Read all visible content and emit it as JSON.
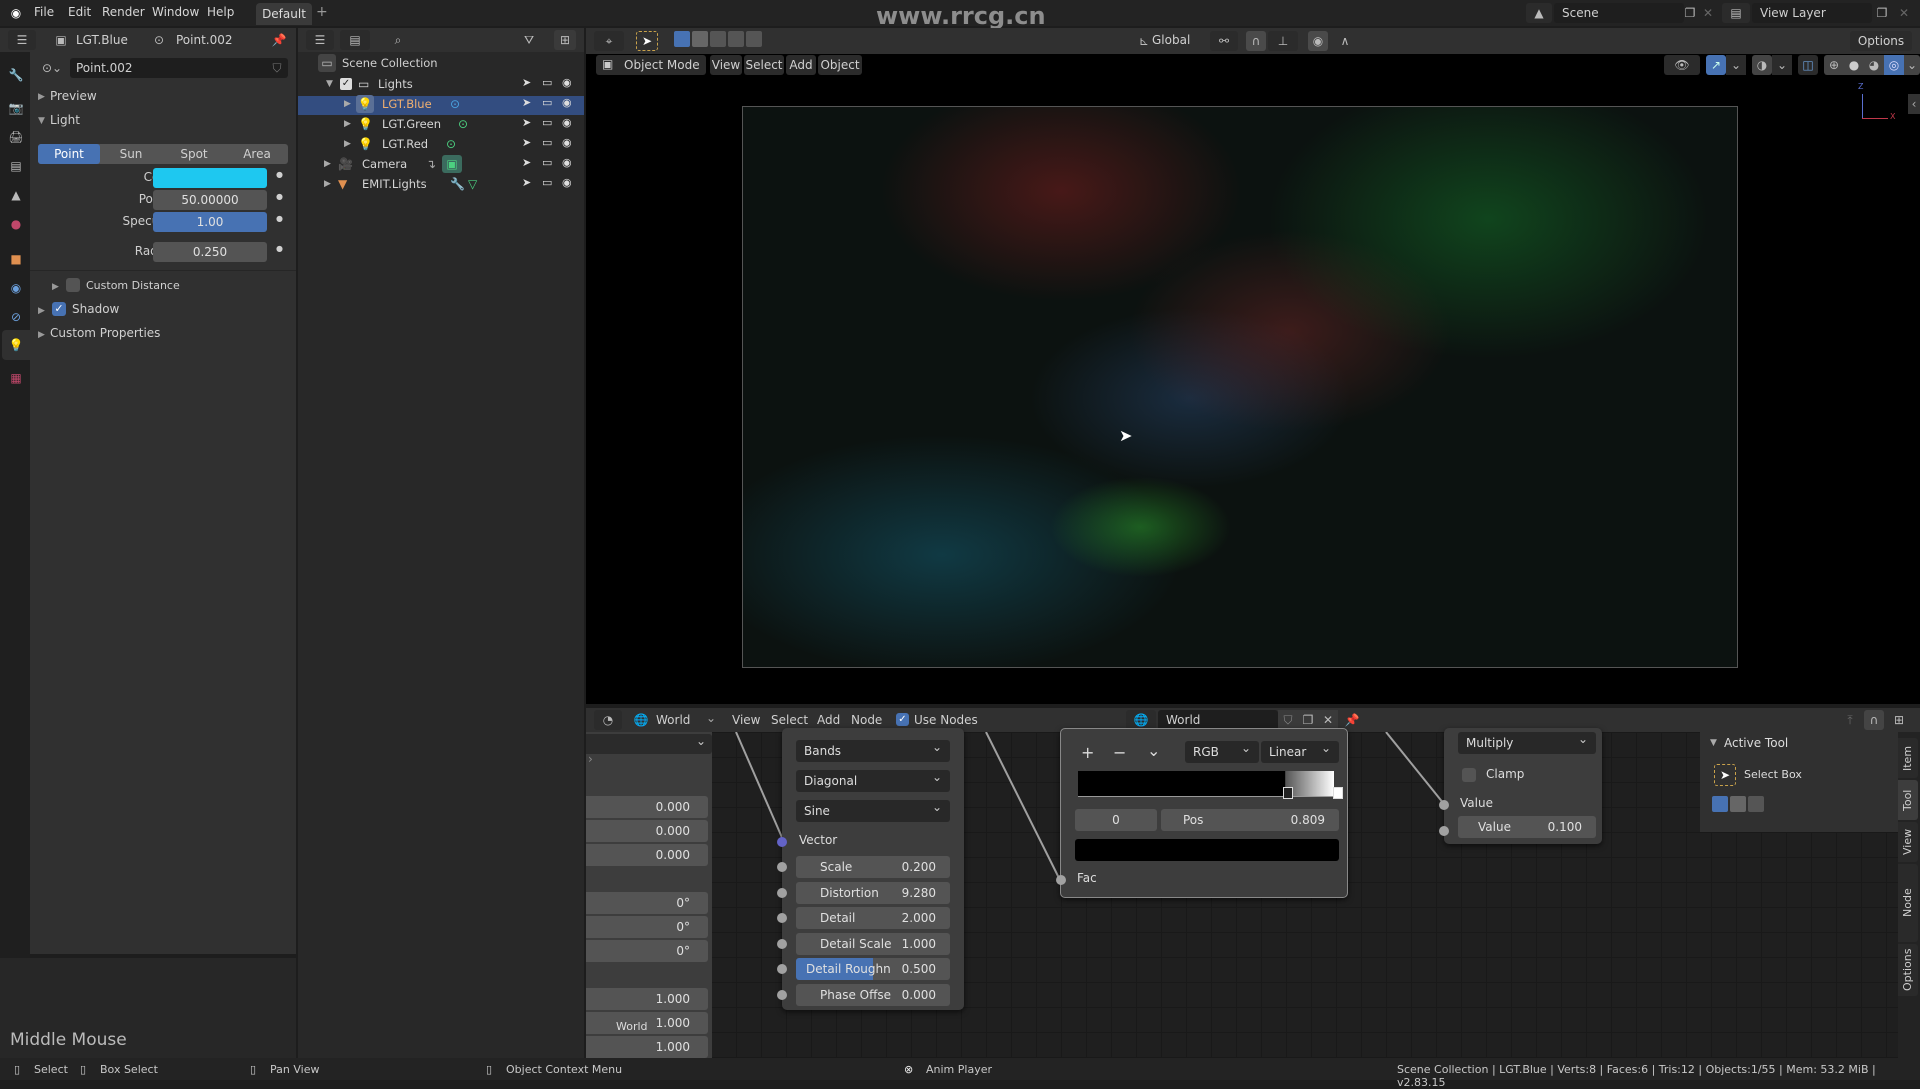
{
  "topbar": {
    "menus": [
      "File",
      "Edit",
      "Render",
      "Window",
      "Help"
    ],
    "workspace_tab": "Default",
    "scene": "Scene",
    "view_layer": "View Layer",
    "watermark": "www.rrcg.cn"
  },
  "properties": {
    "object_name": "LGT.Blue",
    "data_name": "Point.002",
    "datablock": "Point.002",
    "panels": {
      "preview": "Preview",
      "light": "Light",
      "custom_distance": "Custom Distance",
      "shadow": "Shadow",
      "custom_properties": "Custom Properties"
    },
    "light_types": [
      "Point",
      "Sun",
      "Spot",
      "Area"
    ],
    "active_type": "Point",
    "fields": {
      "color_label": "Color",
      "power_label": "Power",
      "power": "50.00000",
      "specular_label": "Specular",
      "specular": "1.00",
      "radius_label": "Radius",
      "radius": "0.250"
    },
    "color_value": "#1ec8f0",
    "shadow_checked": true,
    "custom_distance_checked": false
  },
  "outliner": {
    "root": "Scene Collection",
    "items": [
      {
        "name": "Lights",
        "type": "collection"
      },
      {
        "name": "LGT.Blue",
        "type": "light",
        "selected": true
      },
      {
        "name": "LGT.Green",
        "type": "light"
      },
      {
        "name": "LGT.Red",
        "type": "light"
      },
      {
        "name": "Camera",
        "type": "camera"
      },
      {
        "name": "EMIT.Lights",
        "type": "mesh"
      }
    ]
  },
  "viewport": {
    "mode": "Object Mode",
    "menus": [
      "View",
      "Select",
      "Add",
      "Object"
    ],
    "orientation": "Global",
    "options": "Options",
    "axis_z": "Z",
    "axis_x": "X"
  },
  "node_editor": {
    "editor_type": "World",
    "menus": [
      "View",
      "Select",
      "Add",
      "Node"
    ],
    "use_nodes_label": "Use Nodes",
    "use_nodes": true,
    "world_name": "World",
    "left_panel": {
      "values": [
        "0.000",
        "0.000",
        "0.000",
        "0°",
        "0°",
        "0°",
        "1.000",
        "1.000",
        "1.000"
      ],
      "label": "World"
    },
    "wave_node": {
      "dropdowns": [
        "Bands",
        "Diagonal",
        "Sine"
      ],
      "vector": "Vector",
      "inputs": [
        {
          "k": "Scale",
          "v": "0.200"
        },
        {
          "k": "Distortion",
          "v": "9.280"
        },
        {
          "k": "Detail",
          "v": "2.000"
        },
        {
          "k": "Detail Scale",
          "v": "1.000"
        },
        {
          "k": "Detail Roughn",
          "v": "0.500"
        },
        {
          "k": "Phase Offse",
          "v": "0.000"
        }
      ]
    },
    "ramp_node": {
      "color_mode": "RGB",
      "interpolation": "Linear",
      "index": "0",
      "pos_label": "Pos",
      "pos": "0.809",
      "fac": "Fac",
      "plus": "+",
      "minus": "−",
      "chevron": "⌄"
    },
    "math_node": {
      "operation": "Multiply",
      "clamp": "Clamp",
      "value_socket": "Value",
      "value_label": "Value",
      "value": "0.100"
    },
    "sidebar": {
      "active_tool": "Active Tool",
      "select_box": "Select Box",
      "tabs": [
        "Item",
        "Tool",
        "View",
        "Node Wrangler",
        "Options"
      ]
    }
  },
  "statusbar": {
    "select": "Select",
    "box_select": "Box Select",
    "pan_view": "Pan View",
    "context_menu": "Object Context Menu",
    "anim_player": "Anim Player",
    "info": "Scene Collection | LGT.Blue | Verts:8 | Faces:6 | Tris:12 | Objects:1/55 | Mem: 53.2 MiB | v2.83.15",
    "middle_mouse": "Middle Mouse"
  }
}
